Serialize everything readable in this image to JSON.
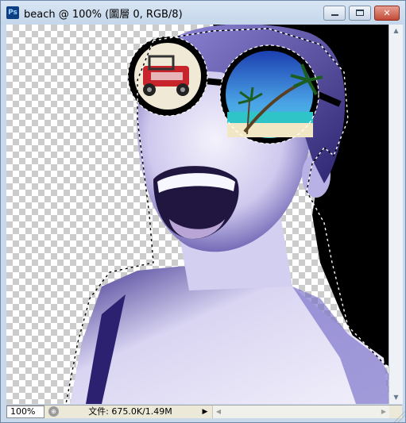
{
  "window": {
    "title": "beach @ 100% (圖層 0, RGB/8)",
    "app_icon_text": "Ps",
    "close_glyph": "✕"
  },
  "status": {
    "zoom": "100%",
    "doc_info": "文件: 675.0K/1.49M"
  },
  "colors": {
    "accent_purple": "#5a4fb4",
    "dark_background": "#000000",
    "skin_tint": "#e6e3f6"
  }
}
